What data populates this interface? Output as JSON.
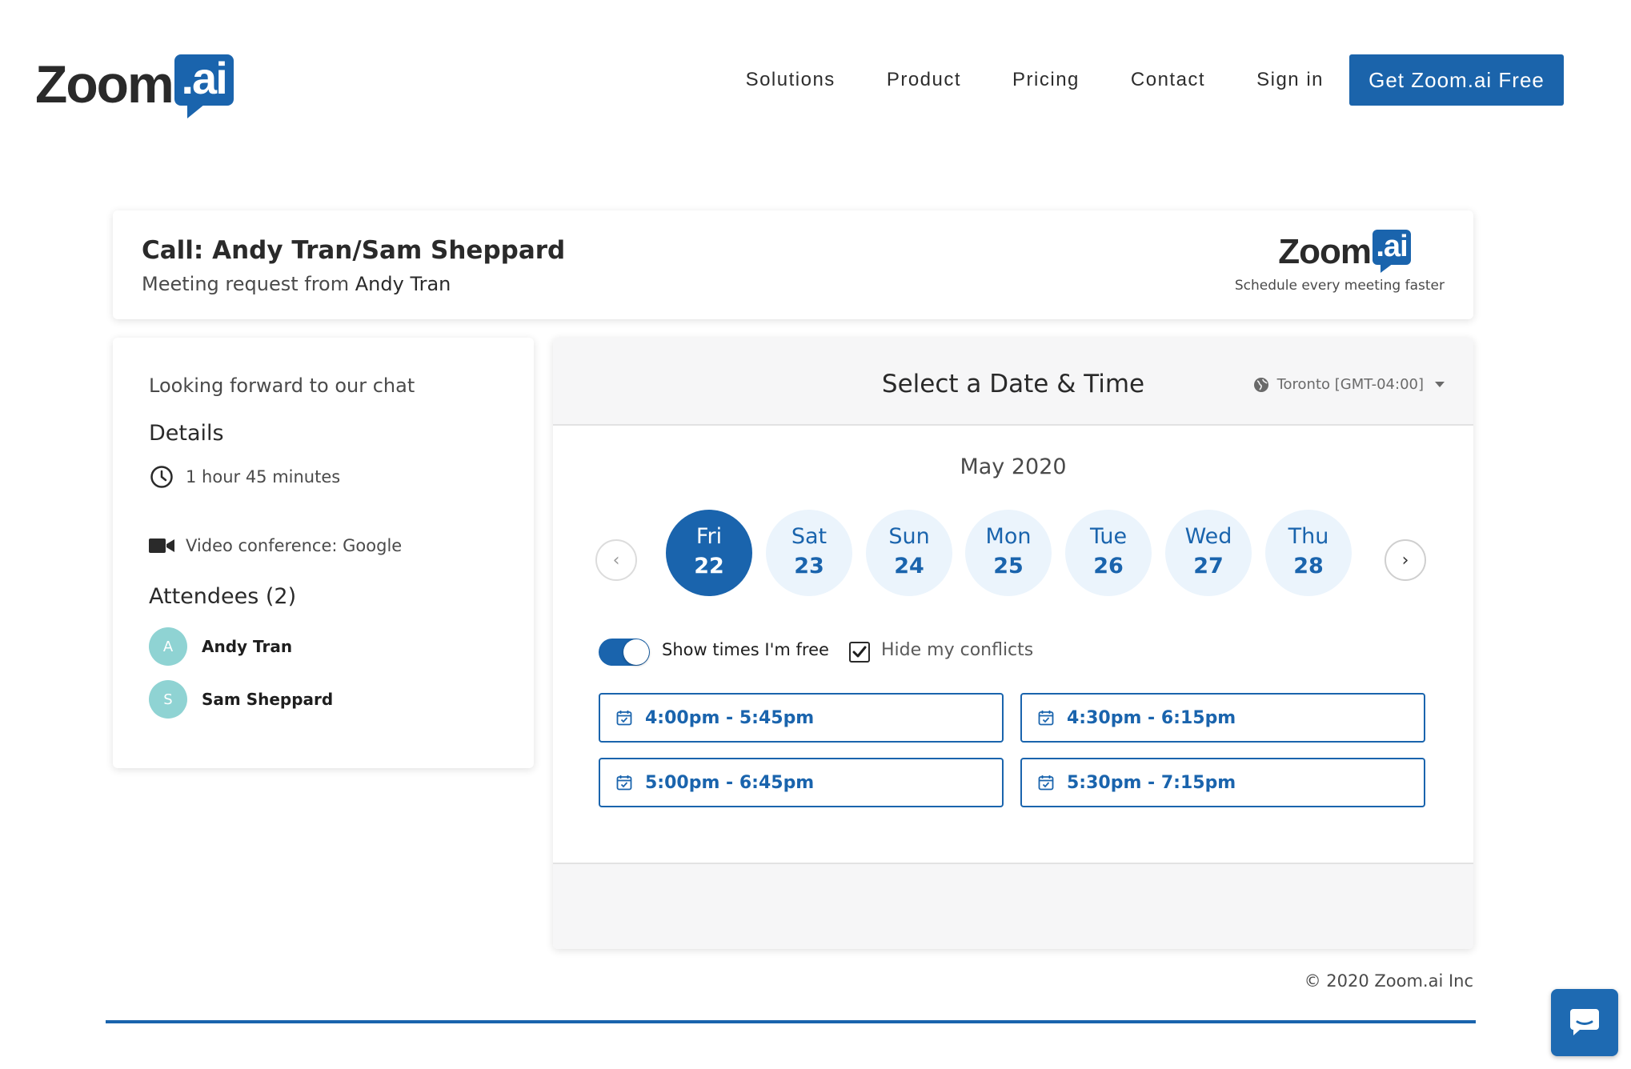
{
  "brand": {
    "word": "Zoom",
    "suffix": ".ai",
    "accent": "#1a64ad"
  },
  "nav": {
    "items": [
      "Solutions",
      "Product",
      "Pricing",
      "Contact",
      "Sign in"
    ],
    "cta": "Get Zoom.ai Free"
  },
  "meeting": {
    "title": "Call: Andy Tran/Sam Sheppard",
    "request_prefix": "Meeting request from",
    "requester": "Andy Tran",
    "tagline": "Schedule every meeting faster"
  },
  "details": {
    "greeting": "Looking forward to our chat",
    "heading": "Details",
    "duration": "1 hour 45 minutes",
    "conference": "Video conference: Google",
    "attendees_heading": "Attendees (2)",
    "attendees": [
      {
        "initial": "A",
        "name": "Andy Tran"
      },
      {
        "initial": "S",
        "name": "Sam Sheppard"
      }
    ]
  },
  "scheduler": {
    "title": "Select a Date & Time",
    "timezone": "Toronto [GMT-04:00]",
    "month": "May 2020",
    "days": [
      {
        "name": "Fri",
        "date": "22",
        "selected": true
      },
      {
        "name": "Sat",
        "date": "23",
        "selected": false
      },
      {
        "name": "Sun",
        "date": "24",
        "selected": false
      },
      {
        "name": "Mon",
        "date": "25",
        "selected": false
      },
      {
        "name": "Tue",
        "date": "26",
        "selected": false
      },
      {
        "name": "Wed",
        "date": "27",
        "selected": false
      },
      {
        "name": "Thu",
        "date": "28",
        "selected": false
      }
    ],
    "show_free_label": "Show times I'm free",
    "show_free_on": true,
    "hide_conflicts_label": "Hide my conflicts",
    "hide_conflicts_checked": true,
    "slots": [
      "4:00pm - 5:45pm",
      "4:30pm - 6:15pm",
      "5:00pm - 6:45pm",
      "5:30pm - 7:15pm"
    ]
  },
  "footer": {
    "copyright": "© 2020 Zoom.ai Inc"
  }
}
